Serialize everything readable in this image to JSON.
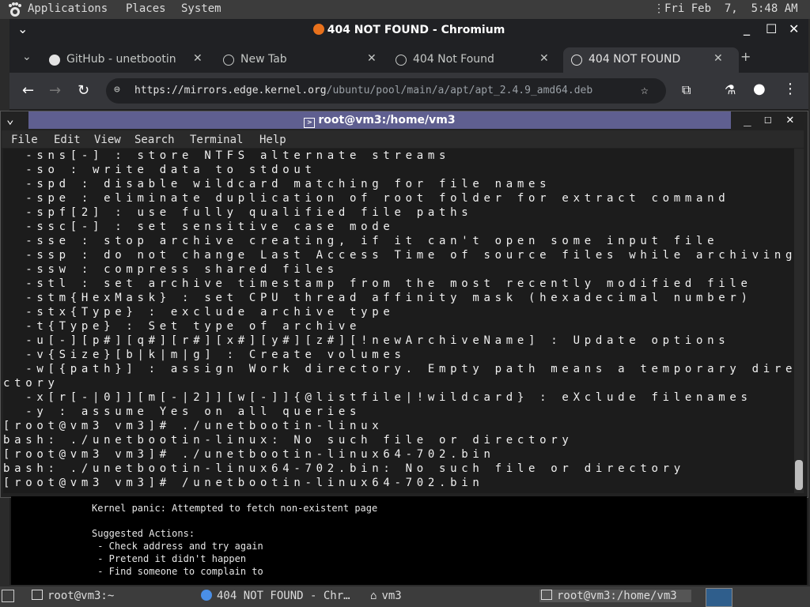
{
  "top_panel": {
    "menus": [
      "Applications",
      "Places",
      "System"
    ],
    "clock": "Fri Feb  7,  5:48 AM"
  },
  "chrome": {
    "window_title": "404 NOT FOUND - Chromium",
    "tabs": [
      {
        "label": "GitHub - unetbootin",
        "active": false
      },
      {
        "label": "New Tab",
        "active": false
      },
      {
        "label": "404 Not Found",
        "active": false
      },
      {
        "label": "404 NOT FOUND",
        "active": true
      }
    ],
    "url_host": "https://mirrors.edge.kernel.org",
    "url_path": "/ubuntu/pool/main/a/apt/apt_2.4.9_amd64.deb"
  },
  "terminal": {
    "title": "root@vm3:/home/vm3",
    "menus": [
      "File",
      "Edit",
      "View",
      "Search",
      "Terminal",
      "Help"
    ],
    "lines": [
      "  -sns[-] : store NTFS alternate streams",
      "  -so : write data to stdout",
      "  -spd : disable wildcard matching for file names",
      "  -spe : eliminate duplication of root folder for extract command",
      "  -spf[2] : use fully qualified file paths",
      "  -ssc[-] : set sensitive case mode",
      "  -sse : stop archive creating, if it can't open some input file",
      "  -ssp : do not change Last Access Time of source files while archiving",
      "  -ssw : compress shared files",
      "  -stl : set archive timestamp from the most recently modified file",
      "  -stm{HexMask} : set CPU thread affinity mask (hexadecimal number)",
      "  -stx{Type} : exclude archive type",
      "  -t{Type} : Set type of archive",
      "  -u[-][p#][q#][r#][x#][y#][z#][!newArchiveName] : Update options",
      "  -v{Size}[b|k|m|g] : Create volumes",
      "  -w[{path}] : assign Work directory. Empty path means a temporary dire",
      "ctory",
      "  -x[r[-|0]][m[-|2]][w[-]]{@listfile|!wildcard} : eXclude filenames",
      "  -y : assume Yes on all queries",
      "[root@vm3 vm3]# ./unetbootin-linux",
      "bash: ./unetbootin-linux: No such file or directory",
      "[root@vm3 vm3]# ./unetbootin-linux64-702.bin",
      "bash: ./unetbootin-linux64-702.bin: No such file or directory",
      "[root@vm3 vm3]# /unetbootin-linux64-702.bin"
    ]
  },
  "page": {
    "panic": "Kernel panic: Attempted to fetch non-existent page",
    "actions_title": "Suggested Actions:",
    "actions": [
      " - Check address and try again",
      " - Pretend it didn't happen",
      " - Find someone to complain to"
    ]
  },
  "taskbar": {
    "items": [
      "root@vm3:~",
      "404 NOT FOUND - Chr…",
      "vm3",
      "root@vm3:/home/vm3"
    ]
  }
}
